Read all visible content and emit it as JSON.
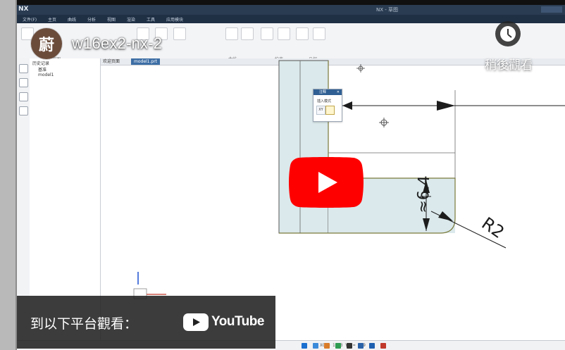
{
  "video": {
    "channel_avatar_text": "蔚",
    "title": "w16ex2-nx-2",
    "watch_later_label": "稍後觀看",
    "watch_on_text": "到以下平台觀看：",
    "youtube_wordmark": "YouTube"
  },
  "nx_app": {
    "logo": "NX",
    "menu_items": [
      "文件(F)",
      "主页",
      "曲线",
      "分析",
      "视图",
      "渲染",
      "工具",
      "应用模块"
    ],
    "ribbon_groups": [
      "直接草图",
      "曲线",
      "约束",
      "几何"
    ],
    "tabs": [
      "欢迎页面",
      "model1.prt"
    ],
    "tree_items": [
      "历史记录",
      "基准",
      "model1"
    ],
    "dialog": {
      "title": "注释",
      "label": "插入模式",
      "option_1": "XY"
    },
    "dimension_labels": {
      "radius": "R2",
      "approx": "≈6.4"
    },
    "status": {
      "x_coord": "XC = 12.3",
      "y_coord": "YC = -49"
    }
  },
  "colors": {
    "youtube_red": "#ff0000",
    "dark_overlay": "#212121",
    "part_fill": "#dbe9ec",
    "arrow_black": "#1c1c1c",
    "avatar_bg": "#6b4c3b",
    "nx_titlebar": "#2a3c52"
  },
  "icons": [
    "watch-later-icon",
    "play-icon",
    "youtube-logo-icon",
    "center-crosshair-icon",
    "axis-triad-icon"
  ]
}
